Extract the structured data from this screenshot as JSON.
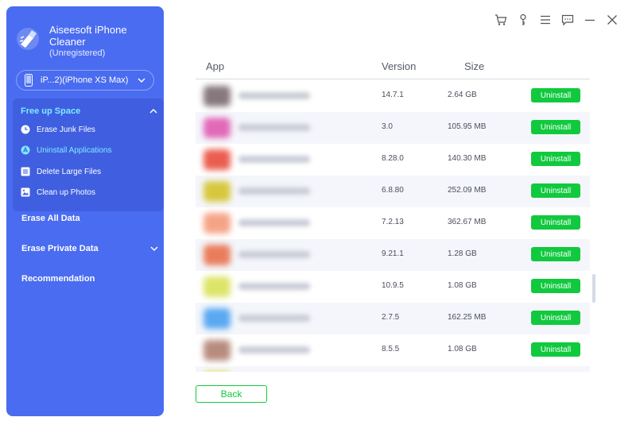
{
  "app": {
    "title": "Aiseesoft iPhone Cleaner",
    "subtitle": "(Unregistered)"
  },
  "device": {
    "label": "iP...2)(iPhone XS Max)"
  },
  "sidebar": {
    "group_title": "Free up Space",
    "sub_items": [
      {
        "label": "Erase Junk Files",
        "icon": "clock-icon"
      },
      {
        "label": "Uninstall Applications",
        "icon": "apps-icon"
      },
      {
        "label": "Delete Large Files",
        "icon": "file-icon"
      },
      {
        "label": "Clean up Photos",
        "icon": "photo-icon"
      }
    ],
    "nav_items": [
      {
        "label": "Erase All Data"
      },
      {
        "label": "Erase Private Data"
      },
      {
        "label": "Recommendation"
      }
    ]
  },
  "table": {
    "headers": {
      "app": "App",
      "version": "Version",
      "size": "Size"
    },
    "action_label": "Uninstall",
    "rows": [
      {
        "version": "14.7.1",
        "size": "2.64 GB",
        "icon_color": "#7a6a70"
      },
      {
        "version": "3.0",
        "size": "105.95 MB",
        "icon_color": "#e05ab0"
      },
      {
        "version": "8.28.0",
        "size": "140.30 MB",
        "icon_color": "#e84c3d"
      },
      {
        "version": "6.8.80",
        "size": "252.09 MB",
        "icon_color": "#d4c22a"
      },
      {
        "version": "7.2.13",
        "size": "362.67 MB",
        "icon_color": "#f49a7a"
      },
      {
        "version": "9.21.1",
        "size": "1.28 GB",
        "icon_color": "#e8704a"
      },
      {
        "version": "10.9.5",
        "size": "1.08 GB",
        "icon_color": "#d9e25a"
      },
      {
        "version": "2.7.5",
        "size": "162.25 MB",
        "icon_color": "#4aa0f0"
      },
      {
        "version": "8.5.5",
        "size": "1.08 GB",
        "icon_color": "#b08070"
      }
    ]
  },
  "footer": {
    "back_label": "Back"
  },
  "colors": {
    "sidebar": "#4a6cf0",
    "accent_green": "#11c93e",
    "active_text": "#7fe9ff"
  }
}
